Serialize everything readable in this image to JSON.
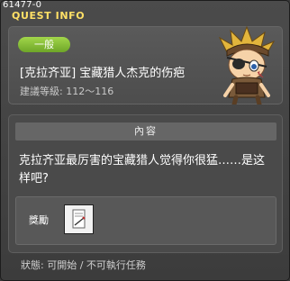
{
  "header": {
    "quest_id": "61477-0",
    "title": "QUEST INFO"
  },
  "quest": {
    "category": "一般",
    "name": "[克拉齐亚] 宝藏猎人杰克的伤疤",
    "level": "建議等級: 112～116"
  },
  "content": {
    "header": "內容",
    "text": "克拉齐亚最厉害的宝藏猎人觉得你很猛……是这样吧?"
  },
  "reward": {
    "label": "獎勵",
    "item_icon": "scroll-icon"
  },
  "status": "狀態: 可開始 / 不可執行任務",
  "colors": {
    "title": "#ffe066",
    "badge": "#8cc63e",
    "window_bg": "#444444"
  }
}
